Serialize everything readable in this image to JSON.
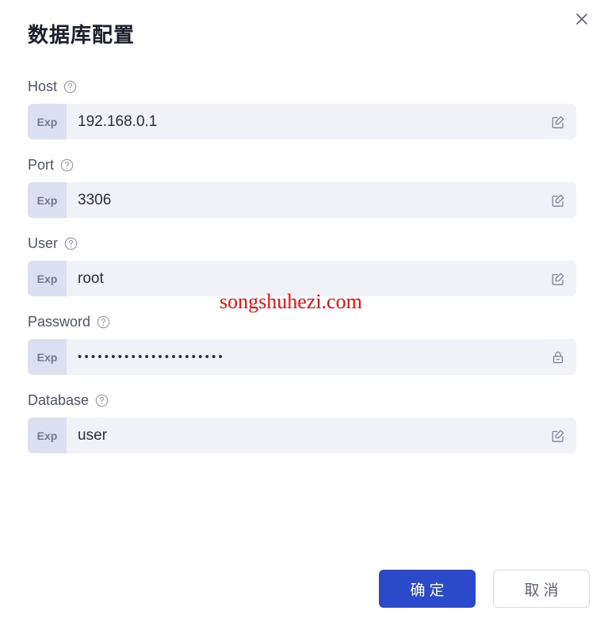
{
  "dialog": {
    "title": "数据库配置",
    "close_icon": "close-icon"
  },
  "fields": [
    {
      "label": "Host",
      "help_icon": "help-circle-icon",
      "badge": "Exp",
      "value": "192.168.0.1",
      "placeholder": "",
      "action_icon": "edit-square-icon",
      "masked": false
    },
    {
      "label": "Port",
      "help_icon": "help-circle-icon",
      "badge": "Exp",
      "value": "3306",
      "placeholder": "",
      "action_icon": "edit-square-icon",
      "masked": false
    },
    {
      "label": "User",
      "help_icon": "help-circle-icon",
      "badge": "Exp",
      "value": "root",
      "placeholder": "",
      "action_icon": "edit-square-icon",
      "masked": false
    },
    {
      "label": "Password",
      "help_icon": "help-circle-icon",
      "badge": "Exp",
      "value": "••••••••••••••••••••••",
      "placeholder": "",
      "action_icon": "lock-icon",
      "masked": true
    },
    {
      "label": "Database",
      "help_icon": "help-circle-icon",
      "badge": "Exp",
      "value": "user",
      "placeholder": "",
      "action_icon": "edit-square-icon",
      "masked": false
    }
  ],
  "watermark": {
    "text": "songshuhezi.com"
  },
  "footer": {
    "confirm_label": "确定",
    "cancel_label": "取消"
  },
  "colors": {
    "primary": "#2b4acb",
    "input_bg": "#f0f2f7",
    "badge_bg": "#dcdff0",
    "label_text": "#4d5466",
    "watermark": "#fa0707"
  }
}
